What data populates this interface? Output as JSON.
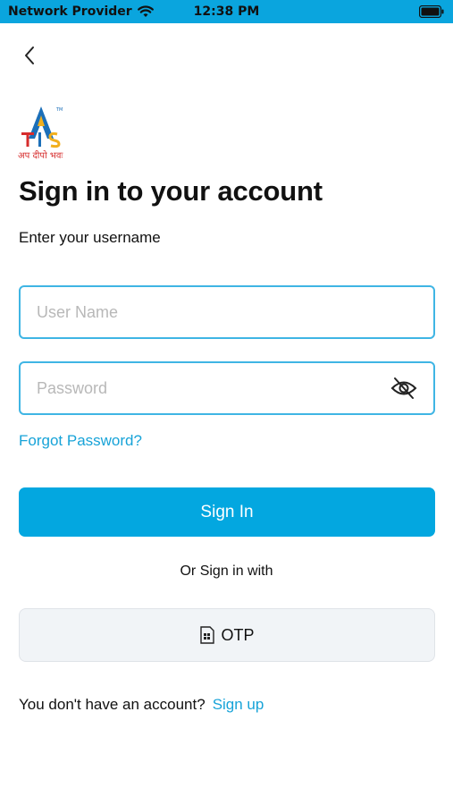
{
  "status_bar": {
    "carrier": "Network Provider",
    "time": "12:38 PM",
    "icons": [
      "wifi-icon",
      "battery-icon"
    ]
  },
  "header": {
    "back_icon": "chevron-left-icon"
  },
  "logo": {
    "letters": "TIS",
    "tagline": "अप दीपो भवः",
    "trademark": "TM",
    "colors": {
      "blue": "#1c6fb8",
      "red": "#d62c2c",
      "yellow": "#f2b01e"
    }
  },
  "title": "Sign in to your account",
  "subtitle": "Enter your username",
  "form": {
    "username": {
      "placeholder": "User Name",
      "value": ""
    },
    "password": {
      "placeholder": "Password",
      "value": "",
      "toggle_icon": "eye-off-icon"
    },
    "forgot_label": "Forgot Password?",
    "signin_label": "Sign In"
  },
  "alt_signin": {
    "divider_text": "Or Sign in with",
    "otp_label": "OTP",
    "otp_icon": "sim-card-icon"
  },
  "signup": {
    "prompt": "You don't have an account?",
    "link_label": "Sign up"
  },
  "colors": {
    "accent": "#03a7e0",
    "link": "#17a3d8",
    "field_border": "#3fb5e4",
    "status_bar": "#0aa5de"
  }
}
